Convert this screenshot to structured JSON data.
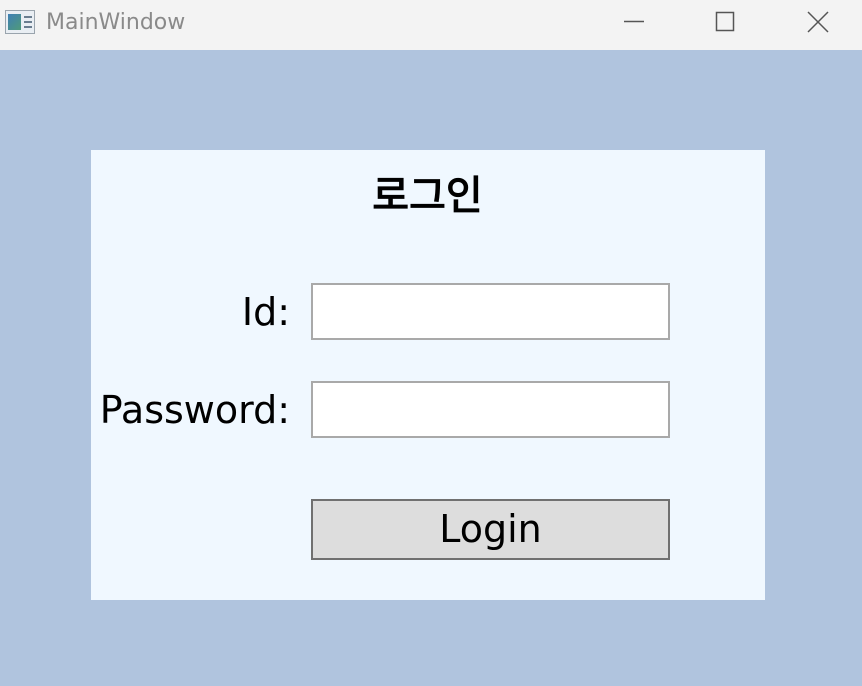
{
  "window": {
    "title": "MainWindow",
    "icon": "app-window-icon",
    "controls": {
      "minimize_icon": "minimize-icon",
      "maximize_icon": "maximize-icon",
      "close_icon": "close-icon"
    }
  },
  "colors": {
    "background": "#b0c4de",
    "panel": "#f0f8ff",
    "titlebar": "#f3f3f3",
    "button": "#dddddd"
  },
  "login": {
    "heading": "로그인",
    "id_label": "Id:",
    "id_value": "",
    "password_label": "Password:",
    "password_value": "",
    "button_label": "Login"
  }
}
